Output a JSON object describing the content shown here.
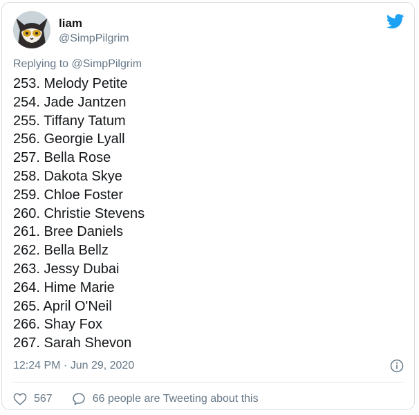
{
  "user": {
    "display_name": "liam",
    "handle": "@SimpPilgrim",
    "avatar_icon": "cartoon-cat-avatar"
  },
  "brand": {
    "logo_icon": "twitter-bird-icon",
    "color": "#1DA1F2"
  },
  "reply": {
    "prefix": "Replying to",
    "mention": "@SimpPilgrim"
  },
  "tweet": {
    "lines": [
      "253. Melody Petite",
      "254. Jade Jantzen",
      "255. Tiffany Tatum",
      "256. Georgie Lyall",
      "257. Bella Rose",
      "258. Dakota Skye",
      "259. Chloe Foster",
      "260. Christie Stevens",
      "261. Bree Daniels",
      "262. Bella Bellz",
      "263. Jessy Dubai",
      "264. Hime Marie",
      "265. April O'Neil",
      "266. Shay Fox",
      "267. Sarah Shevon"
    ],
    "timestamp": "12:24 PM · Jun 29, 2020"
  },
  "actions": {
    "likes": "567",
    "tweeting_about": "66 people are Tweeting about this"
  }
}
